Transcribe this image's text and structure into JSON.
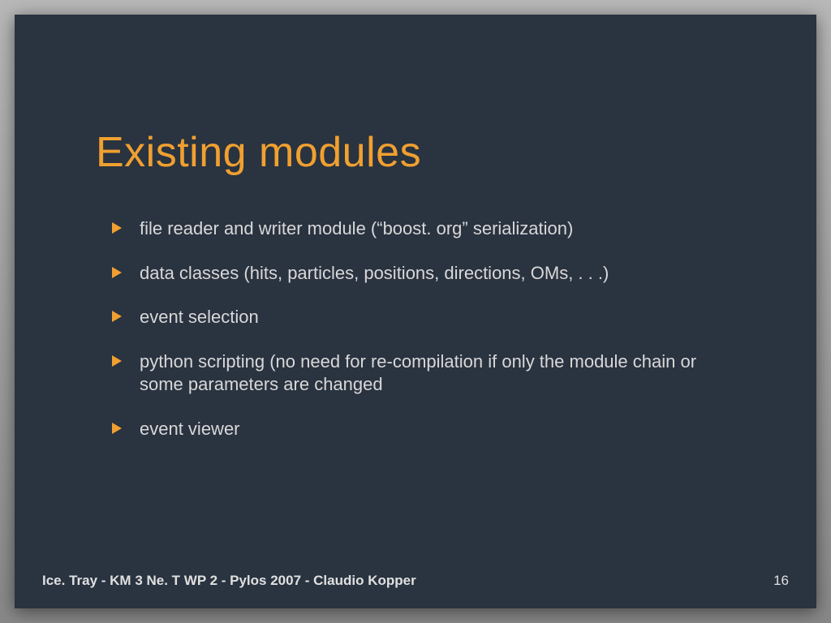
{
  "slide": {
    "title": "Existing modules",
    "bullets": [
      "file reader and writer module (“boost. org” serialization)",
      "data classes (hits, particles, positions, directions, OMs, . . .)",
      "event selection",
      "python scripting (no need for re-compilation if only the module chain or some parameters are changed",
      "event viewer"
    ],
    "footer_left": "Ice. Tray - KM 3 Ne. T WP 2 -  Pylos 2007 - Claudio Kopper",
    "page_number": "16"
  }
}
